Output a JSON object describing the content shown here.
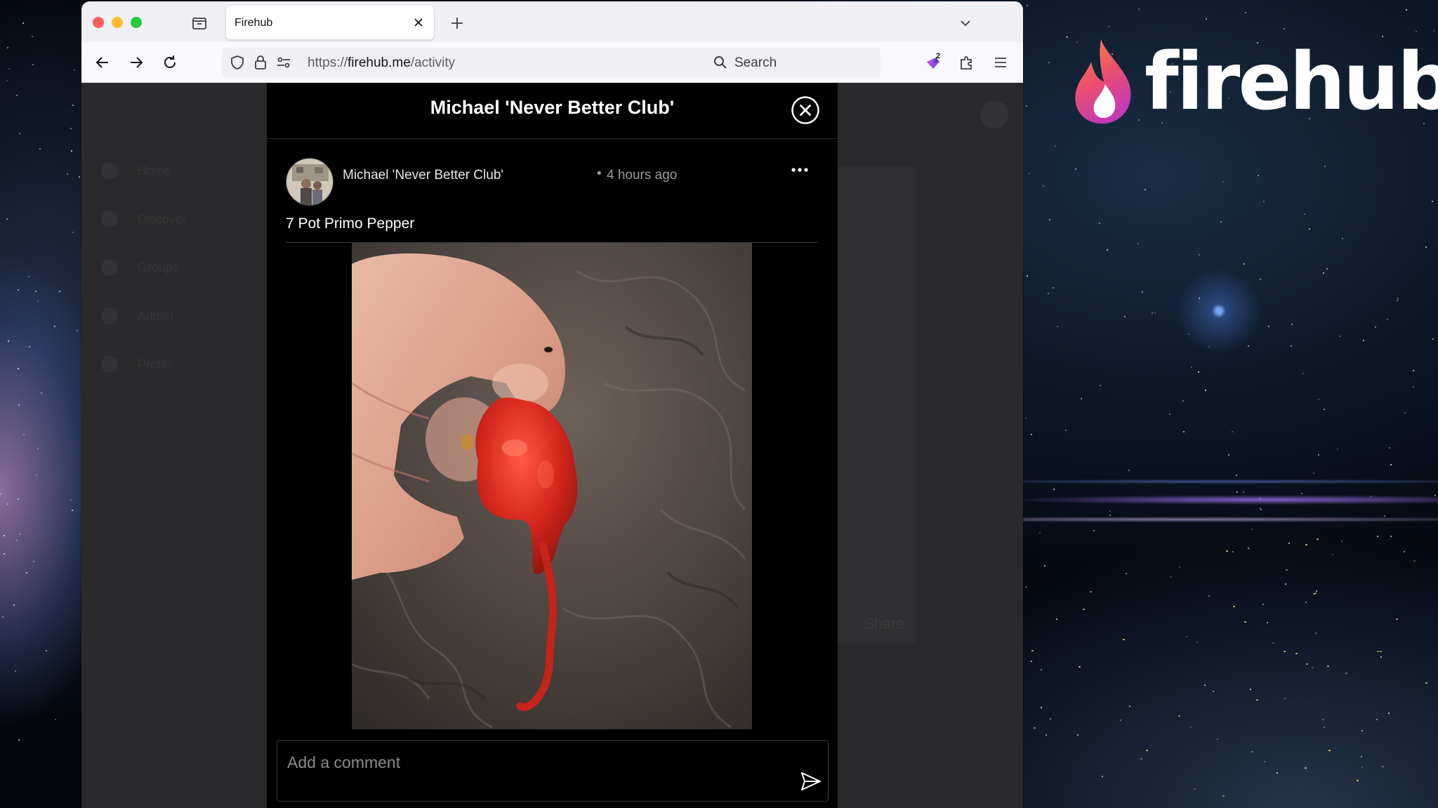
{
  "browser": {
    "tab_title": "Firehub",
    "url_scheme": "https://",
    "url_host": "firehub.me",
    "url_path": "/activity",
    "search_placeholder": "Search",
    "extension_badge": "2"
  },
  "brand": {
    "logo_text": "firehub",
    "flame_colors": [
      "#f26b3a",
      "#e8497a",
      "#c13bb0"
    ]
  },
  "background_page": {
    "nav_items": [
      "Home",
      "Discover",
      "Groups",
      "Admin",
      "Profile"
    ],
    "share_label": "Share"
  },
  "modal": {
    "title": "Michael 'Never Better Club'",
    "post": {
      "author": "Michael 'Never Better Club'",
      "separator": "•",
      "time": "4 hours ago",
      "text": "7 Pot Primo Pepper",
      "image_subject": "red pepper held between fingers"
    },
    "comment": {
      "placeholder": "Add a comment",
      "value": ""
    }
  },
  "colors": {
    "modal_bg": "#000000",
    "page_overlay": "#2a2a2c",
    "pepper_red": "#d4261c"
  }
}
